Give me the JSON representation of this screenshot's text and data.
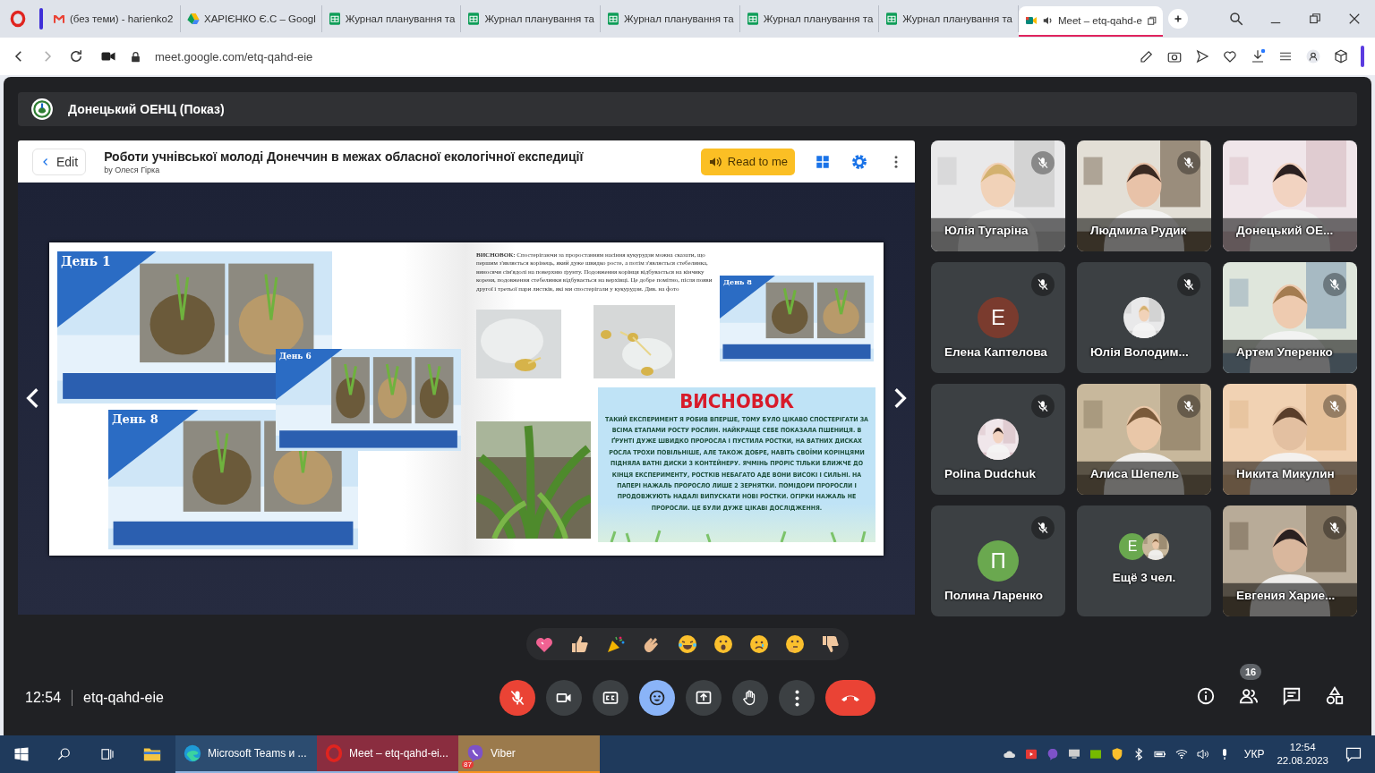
{
  "browser": {
    "tabs": [
      {
        "title": "(без теми) - harienko2",
        "kind": "gmail",
        "selected": false,
        "audio": false
      },
      {
        "title": "ХАРІЄНКО Є.С – Googl",
        "kind": "drive",
        "selected": false,
        "audio": false
      },
      {
        "title": "Журнал планування та",
        "kind": "sheets",
        "selected": false,
        "audio": false
      },
      {
        "title": "Журнал планування та",
        "kind": "sheets",
        "selected": false,
        "audio": false
      },
      {
        "title": "Журнал планування та",
        "kind": "sheets",
        "selected": false,
        "audio": false
      },
      {
        "title": "Журнал планування та",
        "kind": "sheets",
        "selected": false,
        "audio": false
      },
      {
        "title": "Журнал планування та",
        "kind": "sheets",
        "selected": false,
        "audio": false
      },
      {
        "title": "Meet – etq-qahd-e",
        "kind": "meet",
        "selected": true,
        "audio": true
      }
    ],
    "url": "meet.google.com/etq-qahd-eie"
  },
  "meeting_header": {
    "title": "Донецький ОЕНЦ (Показ)"
  },
  "presentation": {
    "edit_label": "Edit",
    "title": "Роботи учнівської молоді Донеччин в межах обласної екологічної експедиції",
    "author": "by Олеся Гірка",
    "read_button": "Read to me",
    "left_page": {
      "slides": [
        {
          "label": "День 1"
        },
        {
          "label": "День 6"
        },
        {
          "label": "День 8"
        }
      ]
    },
    "right_page": {
      "paragraph": "**ВИСНОВОК:** Спостерігаючи за проростанням насіння кукурудзи можна сказати, що першим з'являється корінець, який дуже швидко росте, а потім з'являється стебелинка, виносячи сім'ядолі на поверхню ґрунту. Подовження корінця відбувається на кінчику кореня, подовження стебелинки відбувається на верхівці. Це добре помітно, після появи другої і третьої пари листків, які ми спостерігали у кукурудзи. Див. на фото",
      "slide_label": "День 8",
      "conclusion_title": "ВИСНОВОК",
      "conclusion_text": "ТАКИЙ ЕКСПЕРИМЕНТ Я РОБИВ ВПЕРШЕ, ТОМУ БУЛО ЦІКАВО СПОСТЕРІГАТИ ЗА ВСІМА ЕТАПАМИ РОСТУ РОСЛИН. НАЙКРАЩЕ СЕБЕ ПОКАЗАЛА ПШЕНИЦЯ. В ҐРУНТІ ДУЖЕ ШВИДКО ПРОРОСЛА І ПУСТИЛА РОСТКИ, НА ВАТНИХ ДИСКАХ РОСЛА ТРОХИ ПОВІЛЬНІШЕ, АЛЕ ТАКОЖ ДОБРЕ, НАВІТЬ СВОЇМИ КОРІНЦЯМИ ПІДНЯЛА ВАТНІ ДИСКИ З КОНТЕЙНЕРУ. ЯЧМІНЬ ПРОРІС ТІЛЬКИ БЛИЖЧЕ ДО КІНЦЯ ЕКСПЕРИМЕНТУ, РОСТКІВ НЕБАГАТО АДЕ ВОНИ ВИСОКІ І СИЛЬНІ. НА ПАПЕРІ НАЖАЛЬ ПРОРОСЛО ЛИШЕ 2 ЗЕРНЯТКИ. ПОМІДОРИ ПРОРОСЛИ І ПРОДОВЖУЮТЬ НАДАЛІ ВИПУСКАТИ НОВІ РОСТКИ. ОГІРКИ НАЖАЛЬ НЕ ПРОРОСЛИ. ЦЕ БУЛИ ДУЖЕ ЦІКАВІ ДОСЛІДЖЕННЯ."
    }
  },
  "tiles": [
    {
      "name": "Юлія Тугаріна",
      "kind": "video",
      "muted": true
    },
    {
      "name": "Людмила Рудик",
      "kind": "video",
      "muted": true
    },
    {
      "name": "Донецький ОЕ...",
      "kind": "video",
      "muted": false
    },
    {
      "name": "Елена Каптелова",
      "kind": "initial",
      "initial": "Е",
      "color": "#7a3b2e",
      "muted": true
    },
    {
      "name": "Юлія Володим...",
      "muted": true
    },
    {
      "name": "Артем Уперенко",
      "kind": "video",
      "muted": true
    },
    {
      "name": "Polina Dudchuk",
      "muted": true
    },
    {
      "name": "Алиса Шепель",
      "kind": "video",
      "muted": true
    },
    {
      "name": "Никита Микулин",
      "kind": "video",
      "muted": true
    },
    {
      "name": "Полина Ларенко",
      "kind": "initial",
      "initial": "П",
      "color": "#6aa84f",
      "muted": true
    },
    {
      "name": "Ещё 3 чел.",
      "kind": "more",
      "initial": "Е",
      "color": "#6aa84f"
    },
    {
      "name": "Евгения Харие...",
      "kind": "video",
      "muted": true
    }
  ],
  "reactions": [
    {
      "kind": "heart"
    },
    {
      "kind": "thumbs-up"
    },
    {
      "kind": "party"
    },
    {
      "kind": "clap"
    },
    {
      "kind": "laugh"
    },
    {
      "kind": "surprised"
    },
    {
      "kind": "sad"
    },
    {
      "kind": "thinking"
    },
    {
      "kind": "thumbs-down"
    }
  ],
  "controls": {
    "time": "12:54",
    "code": "etq-qahd-eie",
    "buttons": [
      {
        "kind": "mic",
        "on": false
      },
      {
        "kind": "camera",
        "on": true
      },
      {
        "kind": "captions",
        "on": false
      },
      {
        "kind": "reactions",
        "on": true
      },
      {
        "kind": "present",
        "on": false
      },
      {
        "kind": "hand",
        "on": false
      },
      {
        "kind": "more"
      },
      {
        "kind": "leave"
      }
    ],
    "side": [
      {
        "kind": "info"
      },
      {
        "kind": "people",
        "badge": "16"
      },
      {
        "kind": "chat"
      },
      {
        "kind": "activities"
      }
    ]
  },
  "taskbar": {
    "apps": [
      {
        "label": "Microsoft Teams и ...",
        "kind": "edge",
        "selected": false,
        "flashing": false
      },
      {
        "label": "Meet – etq-qahd-ei...",
        "kind": "opera",
        "selected": true,
        "flashing": false
      },
      {
        "label": "Viber",
        "kind": "viber",
        "selected": false,
        "flashing": true,
        "badge": "87"
      }
    ],
    "language": "УКР",
    "time": "12:54",
    "date": "22.08.2023"
  }
}
